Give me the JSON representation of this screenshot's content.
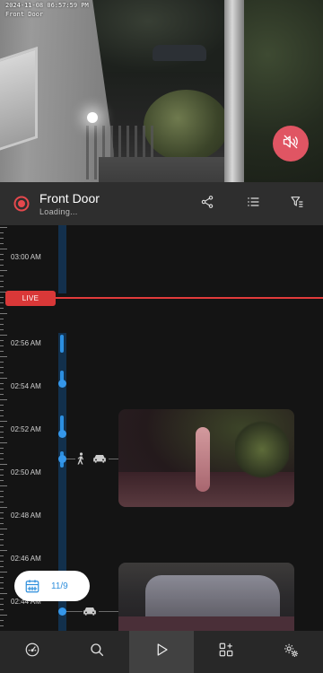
{
  "feed": {
    "timestamp": "2024-11-08 06:57:59 PM",
    "camera_overlay": "Front Door",
    "mute_icon": "speaker-off-icon"
  },
  "header": {
    "title": "Front Door",
    "status": "Loading...",
    "actions": [
      "share-icon",
      "list-icon",
      "filter-icon"
    ]
  },
  "timeline": {
    "live_label": "LIVE",
    "time_labels": [
      "03:00 AM",
      "02:56 AM",
      "02:54 AM",
      "02:52 AM",
      "02:50 AM",
      "02:48 AM",
      "02:46 AM",
      "02:44 AM"
    ],
    "events": [
      {
        "time": "02:51 AM",
        "types": [
          "person",
          "vehicle"
        ]
      },
      {
        "time": "02:44 AM",
        "types": [
          "vehicle"
        ]
      }
    ],
    "date_button": "11/9"
  },
  "bottom_nav": {
    "items": [
      "dashboard-icon",
      "search-icon",
      "play-icon",
      "add-widget-icon",
      "settings-icon"
    ],
    "active": "play-icon"
  },
  "colors": {
    "accent_blue": "#3597ea",
    "live_red": "#d93838",
    "mute_pink": "#e05563",
    "record_red": "#e5484d"
  }
}
